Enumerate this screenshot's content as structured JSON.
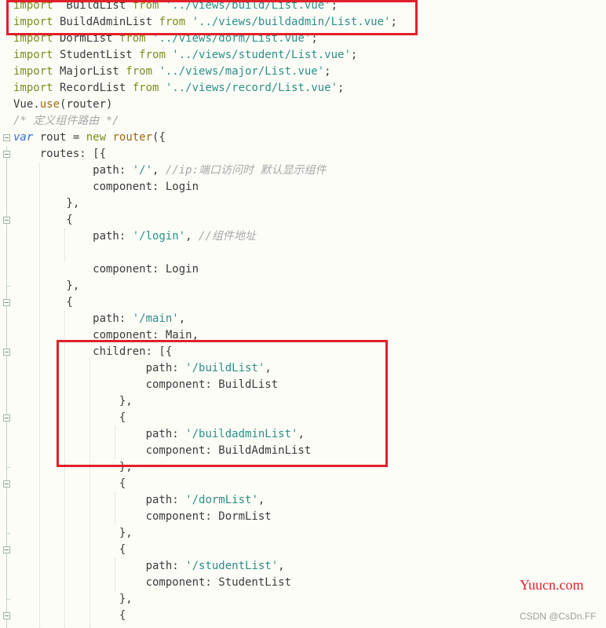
{
  "editor": {
    "lines": [
      {
        "fold": null,
        "tokens": [
          [
            "kw",
            "import"
          ],
          [
            "",
            "  BuildList "
          ],
          [
            "kw",
            "from"
          ],
          [
            "str",
            " '../views/build/List.vue'"
          ],
          [
            "",
            ";"
          ]
        ]
      },
      {
        "fold": null,
        "tokens": [
          [
            "kw",
            "import"
          ],
          [
            "",
            " BuildAdminList "
          ],
          [
            "kw",
            "from"
          ],
          [
            "str",
            " '../views/buildadmin/List.vue'"
          ],
          [
            "",
            ";"
          ]
        ]
      },
      {
        "fold": null,
        "tokens": [
          [
            "kw",
            "import"
          ],
          [
            "",
            " DormList "
          ],
          [
            "kw",
            "from"
          ],
          [
            "str",
            " '../views/dorm/List.vue'"
          ],
          [
            "",
            ";"
          ]
        ]
      },
      {
        "fold": null,
        "tokens": [
          [
            "kw",
            "import"
          ],
          [
            "",
            " StudentList "
          ],
          [
            "kw",
            "from"
          ],
          [
            "str",
            " '../views/student/List.vue'"
          ],
          [
            "",
            ";"
          ]
        ]
      },
      {
        "fold": null,
        "tokens": [
          [
            "kw",
            "import"
          ],
          [
            "",
            " MajorList "
          ],
          [
            "kw",
            "from"
          ],
          [
            "str",
            " '../views/major/List.vue'"
          ],
          [
            "",
            ";"
          ]
        ]
      },
      {
        "fold": null,
        "tokens": [
          [
            "kw",
            "import"
          ],
          [
            "",
            " RecordList "
          ],
          [
            "kw",
            "from"
          ],
          [
            "str",
            " '../views/record/List.vue'"
          ],
          [
            "",
            ";"
          ]
        ]
      },
      {
        "fold": null,
        "tokens": [
          [
            "",
            "Vue."
          ],
          [
            "fn",
            "use"
          ],
          [
            "",
            "(router)"
          ]
        ]
      },
      {
        "fold": null,
        "tokens": [
          [
            "cm",
            "/* 定义组件路由 */"
          ]
        ]
      },
      {
        "fold": "open",
        "tokens": [
          [
            "kw-var",
            "var"
          ],
          [
            "",
            " rout = "
          ],
          [
            "kw",
            "new"
          ],
          [
            "fn",
            " router"
          ],
          [
            "",
            "({"
          ]
        ]
      },
      {
        "fold": "open",
        "tokens": [
          [
            "",
            "    routes: [{"
          ]
        ]
      },
      {
        "fold": null,
        "tokens": [
          [
            "",
            "            path: "
          ],
          [
            "str",
            "'/'"
          ],
          [
            "",
            ", "
          ],
          [
            "cm",
            "//ip:端口访问时 默认显示组件"
          ]
        ]
      },
      {
        "fold": null,
        "tokens": [
          [
            "",
            "            component: Login"
          ]
        ]
      },
      {
        "fold": null,
        "tokens": [
          [
            "",
            "        },"
          ]
        ]
      },
      {
        "fold": "open",
        "tokens": [
          [
            "",
            "        {"
          ]
        ]
      },
      {
        "fold": null,
        "tokens": [
          [
            "",
            "            path: "
          ],
          [
            "str",
            "'/login'"
          ],
          [
            "",
            ", "
          ],
          [
            "cm",
            "//组件地址"
          ]
        ]
      },
      {
        "fold": null,
        "tokens": []
      },
      {
        "fold": null,
        "tokens": [
          [
            "",
            "            component: Login"
          ]
        ]
      },
      {
        "fold": "end",
        "tokens": [
          [
            "",
            "        },"
          ]
        ]
      },
      {
        "fold": "open",
        "tokens": [
          [
            "",
            "        {"
          ]
        ]
      },
      {
        "fold": null,
        "tokens": [
          [
            "",
            "            path: "
          ],
          [
            "str",
            "'/main'"
          ],
          [
            "",
            ","
          ]
        ]
      },
      {
        "fold": null,
        "tokens": [
          [
            "",
            "            component: Main,"
          ]
        ]
      },
      {
        "fold": "open",
        "tokens": [
          [
            "",
            "            children: [{"
          ]
        ]
      },
      {
        "fold": null,
        "tokens": [
          [
            "",
            "                    path: "
          ],
          [
            "str",
            "'/buildList'"
          ],
          [
            "",
            ","
          ]
        ]
      },
      {
        "fold": null,
        "tokens": [
          [
            "",
            "                    component: BuildList"
          ]
        ]
      },
      {
        "fold": null,
        "tokens": [
          [
            "",
            "                },"
          ]
        ]
      },
      {
        "fold": "open",
        "tokens": [
          [
            "",
            "                {"
          ]
        ]
      },
      {
        "fold": null,
        "tokens": [
          [
            "",
            "                    path: "
          ],
          [
            "str",
            "'/buildadminList'"
          ],
          [
            "",
            ","
          ]
        ]
      },
      {
        "fold": null,
        "tokens": [
          [
            "",
            "                    component: BuildAdminList"
          ]
        ]
      },
      {
        "fold": "end",
        "tokens": [
          [
            "",
            "                },"
          ]
        ]
      },
      {
        "fold": "open",
        "tokens": [
          [
            "",
            "                {"
          ]
        ]
      },
      {
        "fold": null,
        "tokens": [
          [
            "",
            "                    path: "
          ],
          [
            "str",
            "'/dormList'"
          ],
          [
            "",
            ","
          ]
        ]
      },
      {
        "fold": null,
        "tokens": [
          [
            "",
            "                    component: DormList"
          ]
        ]
      },
      {
        "fold": "end",
        "tokens": [
          [
            "",
            "                },"
          ]
        ]
      },
      {
        "fold": "open",
        "tokens": [
          [
            "",
            "                {"
          ]
        ]
      },
      {
        "fold": null,
        "tokens": [
          [
            "",
            "                    path: "
          ],
          [
            "str",
            "'/studentList'"
          ],
          [
            "",
            ","
          ]
        ]
      },
      {
        "fold": null,
        "tokens": [
          [
            "",
            "                    component: StudentList"
          ]
        ]
      },
      {
        "fold": "end",
        "tokens": [
          [
            "",
            "                },"
          ]
        ]
      },
      {
        "fold": "open",
        "tokens": [
          [
            "",
            "                {"
          ]
        ]
      }
    ]
  },
  "watermark": {
    "site": "Yuucn.com",
    "csdn": "CSDN @CsDn.FF"
  },
  "colors": {
    "highlight": "#e0202a"
  }
}
